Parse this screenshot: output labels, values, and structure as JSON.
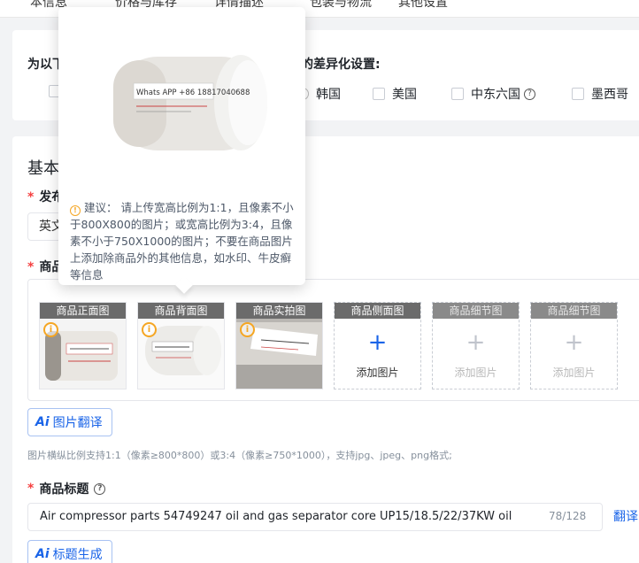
{
  "tabs": [
    "本信息",
    "价格与库存",
    "详情描述",
    "包装与物流",
    "其他设置"
  ],
  "diff": {
    "label_left": "为以下",
    "label_right": "的差异化设置:",
    "countries": [
      "韩国",
      "美国",
      "中东六国",
      "墨西哥"
    ]
  },
  "basic": {
    "section_title": "基本",
    "publish_label": "发布",
    "lang_value": "英文",
    "images_label": "商品"
  },
  "popover": {
    "product_label": "Whats APP +86 18817040688",
    "tip": "建议： 请上传宽高比例为1:1，且像素不小于800X800的图片；或宽高比例为3:4，且像素不小于750X1000的图片；不要在商品图片上添加除商品外的其他信息，如水印、牛皮癣等信息"
  },
  "image_slots": [
    {
      "caption": "商品正面图",
      "filled": true,
      "warn": true
    },
    {
      "caption": "商品背面图",
      "filled": true,
      "warn": true
    },
    {
      "caption": "商品实拍图",
      "filled": true,
      "warn": true
    },
    {
      "caption": "商品侧面图",
      "filled": false,
      "active": true,
      "plus": "+",
      "add_label": "添加图片"
    },
    {
      "caption": "商品细节图",
      "filled": false,
      "active": false,
      "plus": "+",
      "add_label": "添加图片"
    },
    {
      "caption": "商品细节图",
      "filled": false,
      "active": false,
      "plus": "+",
      "add_label": "添加图片"
    }
  ],
  "ai_translate": {
    "ai": "Ai",
    "label": "图片翻译"
  },
  "image_hint": "图片横纵比例支持1:1（像素≥800*800）或3:4（像素≥750*1000），支持jpg、jpeg、png格式;",
  "title_field": {
    "label": "商品标题",
    "value": "Air compressor parts 54749247 oil and gas separator core UP15/18.5/22/37KW oil",
    "counter": "78/128",
    "translate": "翻译"
  },
  "ai_title": {
    "ai": "Ai",
    "label": "标题生成"
  },
  "colors": {
    "accent": "#1a64e8",
    "required": "#f53f3f",
    "warning": "#f5a623"
  }
}
